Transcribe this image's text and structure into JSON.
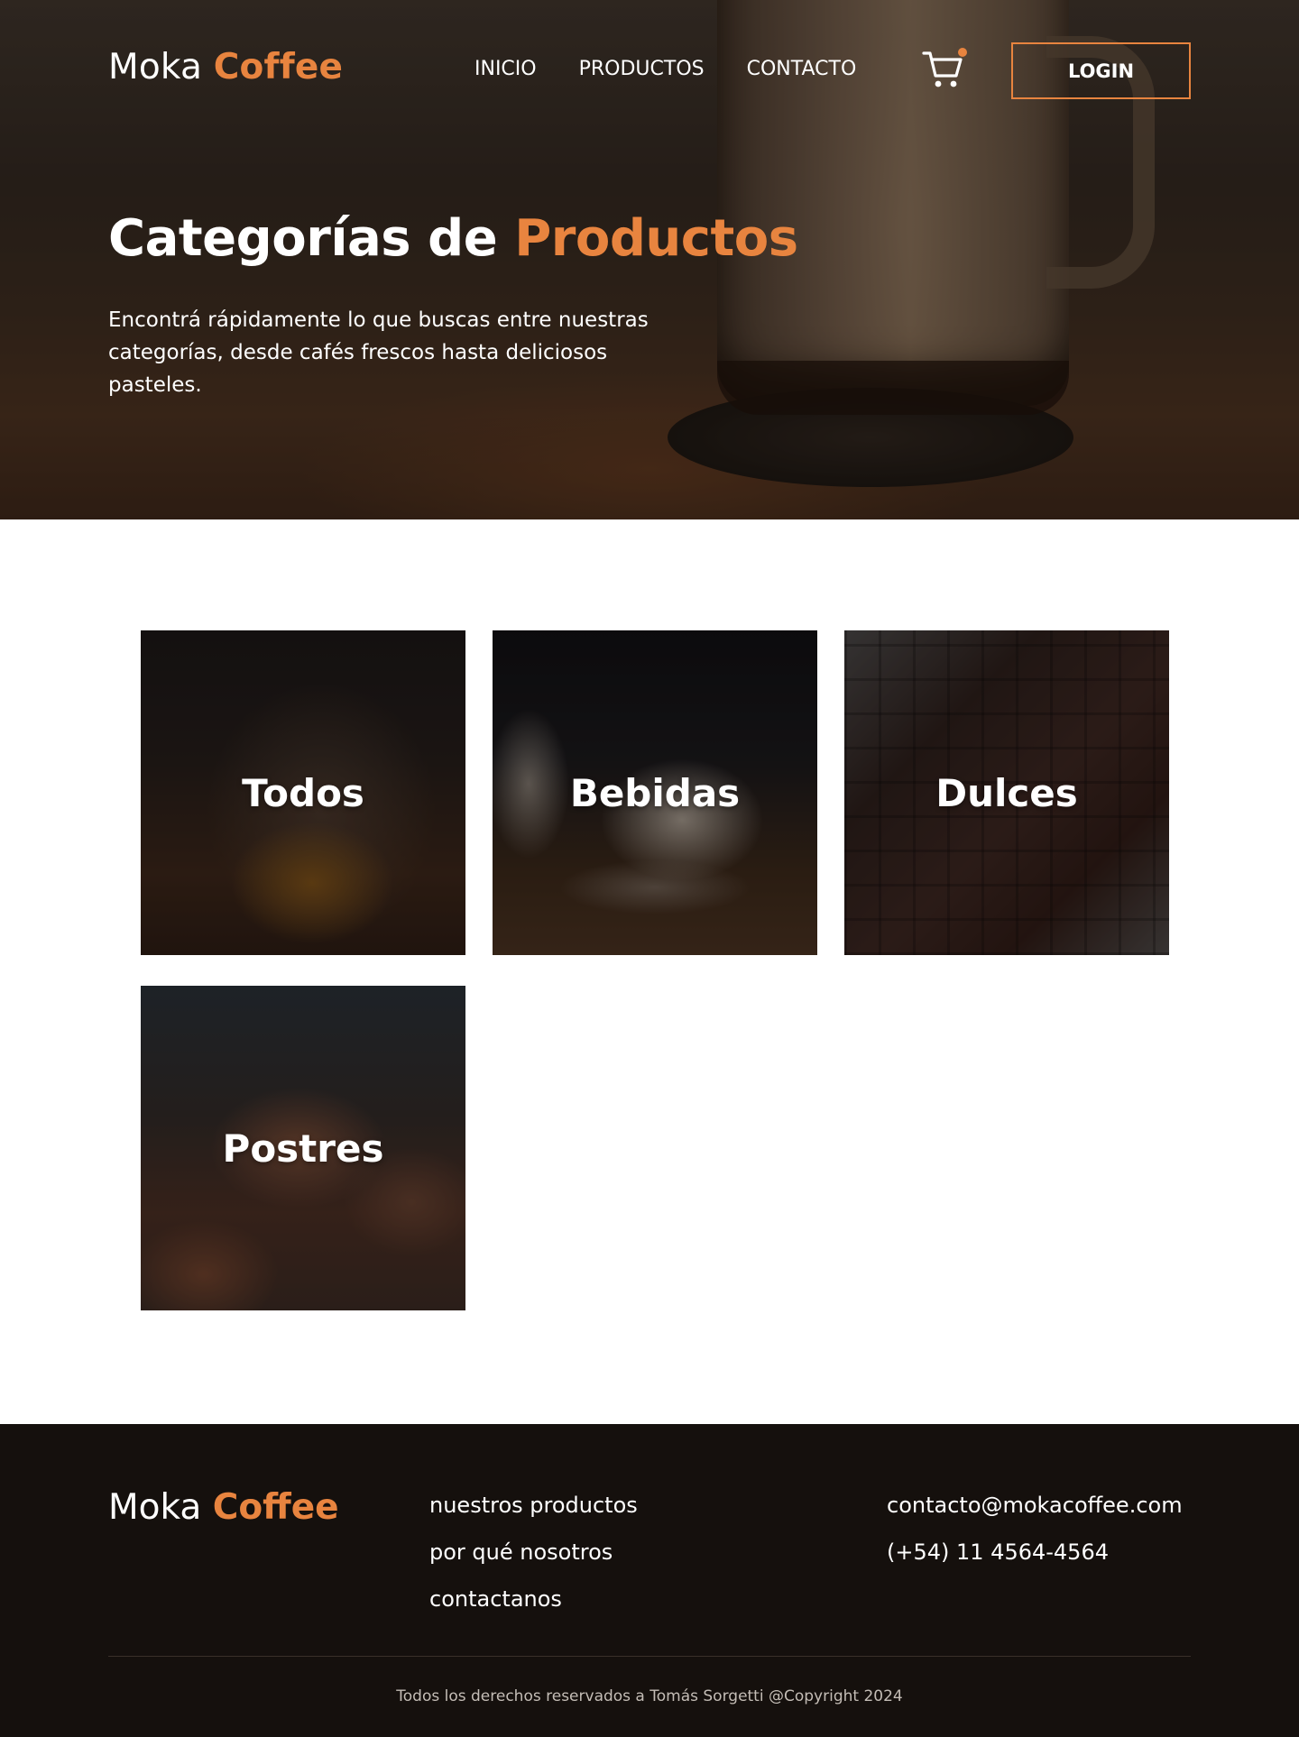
{
  "brand": {
    "name_part1": "Moka",
    "name_part2": "Coffee",
    "accent_color": "#e8843f"
  },
  "nav": {
    "links": [
      {
        "label": "INICIO"
      },
      {
        "label": "PRODUCTOS"
      },
      {
        "label": "CONTACTO"
      }
    ],
    "cart_icon": "shopping-cart-icon",
    "login_label": "LOGIN"
  },
  "hero": {
    "title_part1": "Categorías de",
    "title_part2": "Productos",
    "description": "Encontrá rápidamente lo que buscas entre nuestras categorías, desde cafés frescos hasta deliciosos pasteles."
  },
  "categories": [
    {
      "label": "Todos"
    },
    {
      "label": "Bebidas"
    },
    {
      "label": "Dulces"
    },
    {
      "label": "Postres"
    }
  ],
  "footer": {
    "brand_part1": "Moka",
    "brand_part2": "Coffee",
    "links": [
      {
        "label": "nuestros productos"
      },
      {
        "label": "por qué nosotros"
      },
      {
        "label": "contactanos"
      }
    ],
    "email": "contacto@mokacoffee.com",
    "phone": "(+54) 11 4564-4564",
    "copyright": "Todos los derechos reservados a Tomás Sorgetti @Copyright 2024"
  }
}
